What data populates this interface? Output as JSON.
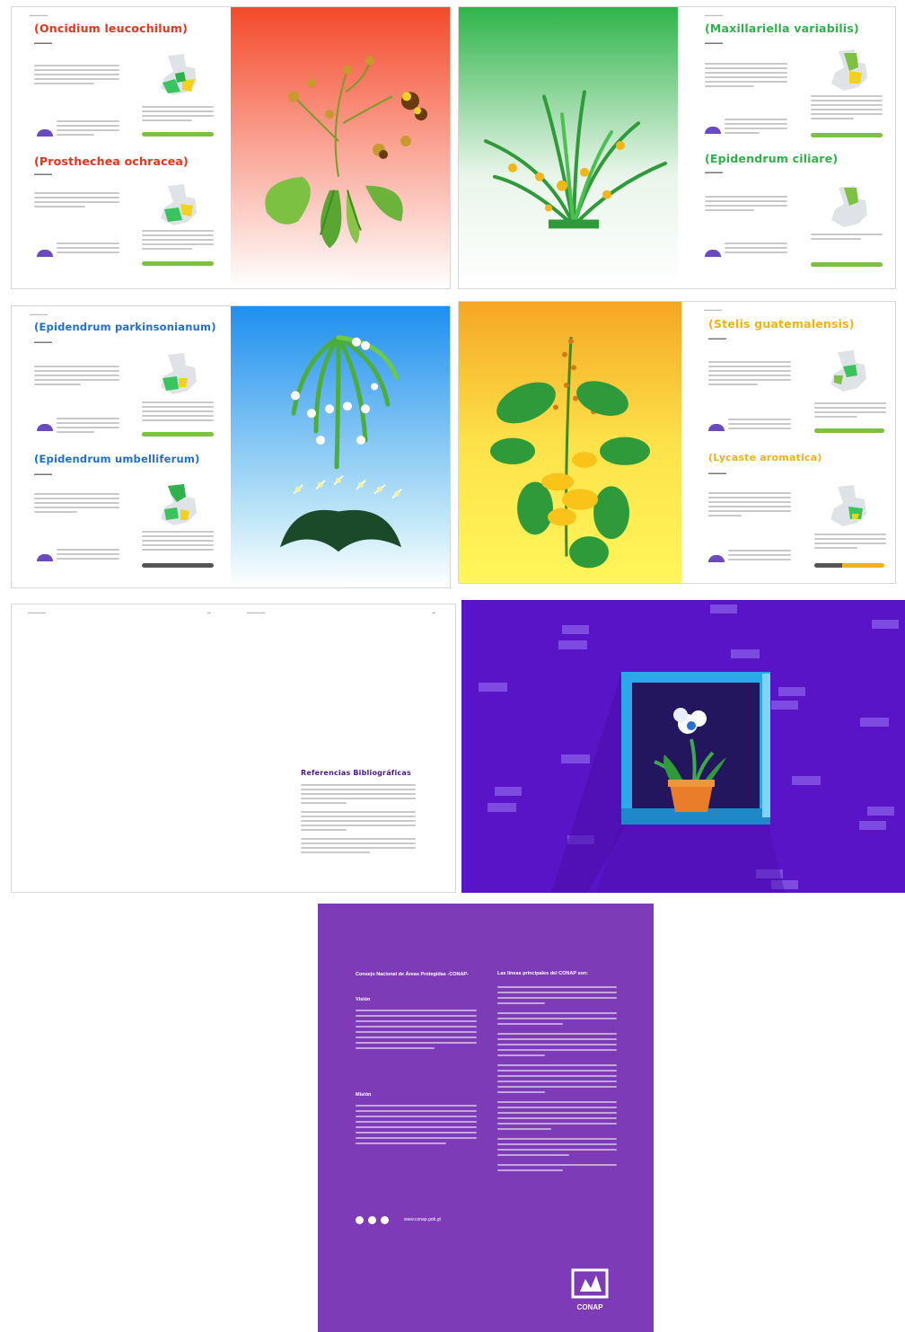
{
  "spreads": [
    {
      "left_page": {
        "species": [
          {
            "name": "(Oncidium leucochilum)",
            "color": "#e8341c"
          },
          {
            "name": "(Prosthechea ochracea)",
            "color": "#e8341c"
          }
        ]
      },
      "illustration": {
        "gradient": [
          "#f44a2b",
          "#ffffff"
        ]
      }
    },
    {
      "illustration": {
        "gradient": [
          "#2fb44a",
          "#ffffff"
        ]
      },
      "right_page": {
        "species": [
          {
            "name": "(Maxillariella variabilis)",
            "color": "#2fb24a"
          },
          {
            "name": "(Epidendrum ciliare)",
            "color": "#2fb24a"
          }
        ]
      }
    },
    {
      "left_page": {
        "species": [
          {
            "name": "(Epidendrum parkinsonianum)",
            "color": "#1f6fd6"
          },
          {
            "name": "(Epidendrum umbelliferum)",
            "color": "#1f6fd6"
          }
        ]
      },
      "illustration": {
        "gradient": [
          "#1f8fef",
          "#ffffff"
        ]
      }
    },
    {
      "illustration": {
        "gradient": [
          "#f5a623",
          "#fff44a"
        ]
      },
      "right_page": {
        "species": [
          {
            "name": "(Stelis guatemalensis)",
            "color": "#f0b21c"
          },
          {
            "name": "(Lycaste aromatica)",
            "color": "#f0b21c"
          }
        ]
      }
    }
  ],
  "references": {
    "heading": "Referencias Bibliográficas",
    "color": "#4a1a8c"
  },
  "window_spread": {
    "background": "#5a14c8"
  },
  "back_cover": {
    "heading_left": "Consejo Nacional de Áreas Protegidas -CONAP-",
    "vision": "Visión",
    "mission": "Misión",
    "heading_right": "Las líneas principales del CONAP son:",
    "url": "www.conap.gob.gt",
    "logo_text": "CONAP",
    "background": "#7d3bb8"
  }
}
